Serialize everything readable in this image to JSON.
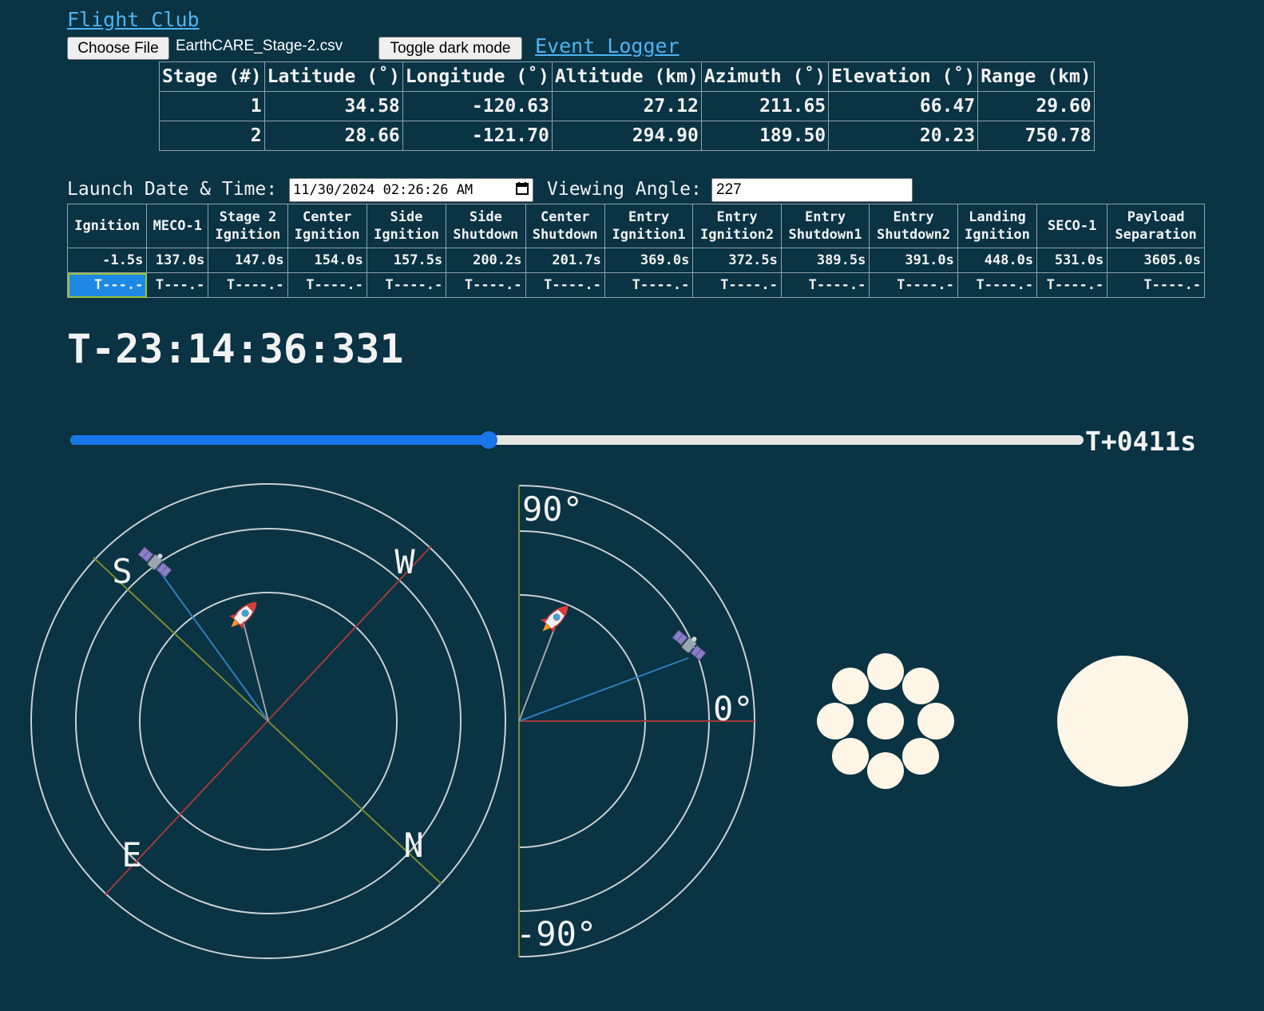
{
  "header": {
    "title": "Flight Club",
    "choose_file_label": "Choose File",
    "file_name": "EarthCARE_Stage-2.csv",
    "toggle_label": "Toggle dark mode",
    "logger_label": "Event Logger"
  },
  "stage_table": {
    "columns": [
      "Stage (#)",
      "Latitude (˚)",
      "Longitude (˚)",
      "Altitude (km)",
      "Azimuth (˚)",
      "Elevation (˚)",
      "Range (km)"
    ],
    "rows": [
      [
        "1",
        "34.58",
        "-120.63",
        "27.12",
        "211.65",
        "66.47",
        "29.60"
      ],
      [
        "2",
        "28.66",
        "-121.70",
        "294.90",
        "189.50",
        "20.23",
        "750.78"
      ]
    ]
  },
  "controls": {
    "launch_label": "Launch Date & Time:",
    "launch_value": "11/30/2024 02:26:26 AM",
    "angle_label": "Viewing Angle:",
    "angle_value": "227"
  },
  "events_table": {
    "headers": [
      [
        "Ignition"
      ],
      [
        "MECO-1"
      ],
      [
        "Stage 2",
        "Ignition"
      ],
      [
        "Center",
        "Ignition"
      ],
      [
        "Side",
        "Ignition"
      ],
      [
        "Side",
        "Shutdown"
      ],
      [
        "Center",
        "Shutdown"
      ],
      [
        "Entry",
        "Ignition1"
      ],
      [
        "Entry",
        "Ignition2"
      ],
      [
        "Entry",
        "Shutdown1"
      ],
      [
        "Entry",
        "Shutdown2"
      ],
      [
        "Landing",
        "Ignition"
      ],
      [
        "SECO-1"
      ],
      [
        "Payload",
        "Separation"
      ]
    ],
    "times": [
      "-1.5s",
      "137.0s",
      "147.0s",
      "154.0s",
      "157.5s",
      "200.2s",
      "201.7s",
      "369.0s",
      "372.5s",
      "389.5s",
      "391.0s",
      "448.0s",
      "531.0s",
      "3605.0s"
    ],
    "countdowns": [
      "T---.-",
      "T---.-",
      "T----.-",
      "T----.-",
      "T----.-",
      "T----.-",
      "T----.-",
      "T----.-",
      "T----.-",
      "T----.-",
      "T----.-",
      "T----.-",
      "T----.-",
      "T----.-"
    ]
  },
  "countdown": "T-23:14:36:331",
  "slider": {
    "value_fraction": 0.413,
    "readout": "T+0411s"
  },
  "compass": {
    "labels": [
      "S",
      "W",
      "E",
      "N"
    ],
    "icons": [
      "satellite-icon",
      "rocket-icon"
    ]
  },
  "elevation_view": {
    "labels": [
      "90°",
      "0°",
      "-90°"
    ]
  },
  "colors": {
    "background": "#0a3343",
    "link": "#4fb4f2",
    "accent": "#1976e6",
    "ring": "#c8d0d2",
    "axis_red": "#a33a3a",
    "axis_olive": "#7a8b2e",
    "sight_blue": "#2f7fc0",
    "cream": "#fdf6e6"
  }
}
